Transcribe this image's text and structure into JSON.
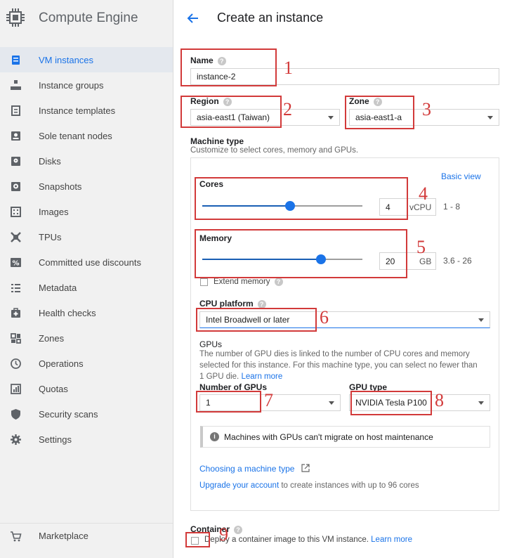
{
  "sidebar": {
    "title": "Compute Engine",
    "items": [
      {
        "label": "VM instances",
        "icon": "vm-instances-icon",
        "active": true
      },
      {
        "label": "Instance groups",
        "icon": "instance-groups-icon"
      },
      {
        "label": "Instance templates",
        "icon": "instance-templates-icon"
      },
      {
        "label": "Sole tenant nodes",
        "icon": "sole-tenant-icon"
      },
      {
        "label": "Disks",
        "icon": "disk-icon"
      },
      {
        "label": "Snapshots",
        "icon": "snapshot-icon"
      },
      {
        "label": "Images",
        "icon": "images-icon"
      },
      {
        "label": "TPUs",
        "icon": "tpu-icon"
      },
      {
        "label": "Committed use discounts",
        "icon": "percent-icon"
      },
      {
        "label": "Metadata",
        "icon": "metadata-icon"
      },
      {
        "label": "Health checks",
        "icon": "health-icon"
      },
      {
        "label": "Zones",
        "icon": "zones-icon"
      },
      {
        "label": "Operations",
        "icon": "clock-icon"
      },
      {
        "label": "Quotas",
        "icon": "quotas-icon"
      },
      {
        "label": "Security scans",
        "icon": "shield-icon"
      },
      {
        "label": "Settings",
        "icon": "gear-icon"
      }
    ],
    "marketplace": "Marketplace"
  },
  "header": {
    "title": "Create an instance"
  },
  "form": {
    "name": {
      "label": "Name",
      "value": "instance-2"
    },
    "region": {
      "label": "Region",
      "value": "asia-east1 (Taiwan)"
    },
    "zone": {
      "label": "Zone",
      "value": "asia-east1-a"
    },
    "machine_type": {
      "label": "Machine type",
      "subtext": "Customize to select cores, memory and GPUs.",
      "basic_view": "Basic view",
      "cores": {
        "label": "Cores",
        "value": "4",
        "unit": "vCPU",
        "range": "1 - 8",
        "level": 0.55
      },
      "memory": {
        "label": "Memory",
        "value": "20",
        "unit": "GB",
        "range": "3.6 - 26",
        "level": 0.74
      },
      "extend_memory": "Extend memory",
      "cpu_platform": {
        "label": "CPU platform",
        "value": "Intel Broadwell or later"
      },
      "gpus": {
        "label": "GPUs",
        "description_line1": "The number of GPU dies is linked to the number of CPU cores and memory",
        "description_line2": "selected for this instance. For this machine type, you can select no fewer than",
        "description_line3": "1 GPU die.",
        "learn_more": "Learn more",
        "number_label": "Number of GPUs",
        "number_value": "1",
        "type_label": "GPU type",
        "type_value": "NVIDIA Tesla P100"
      },
      "notice": "Machines with GPUs can't migrate on host maintenance",
      "choosing_link": "Choosing a machine type",
      "upgrade_link": "Upgrade your account",
      "upgrade_rest": " to create instances with up to 96 cores"
    },
    "container": {
      "label": "Container",
      "checkbox_text": "Deploy a container image to this VM instance.",
      "learn_more": "Learn more"
    }
  },
  "annotations": [
    "1",
    "2",
    "3",
    "4",
    "5",
    "6",
    "7",
    "8",
    "9"
  ],
  "colors": {
    "accent": "#1a73e8",
    "annotation": "#d23a3a"
  }
}
